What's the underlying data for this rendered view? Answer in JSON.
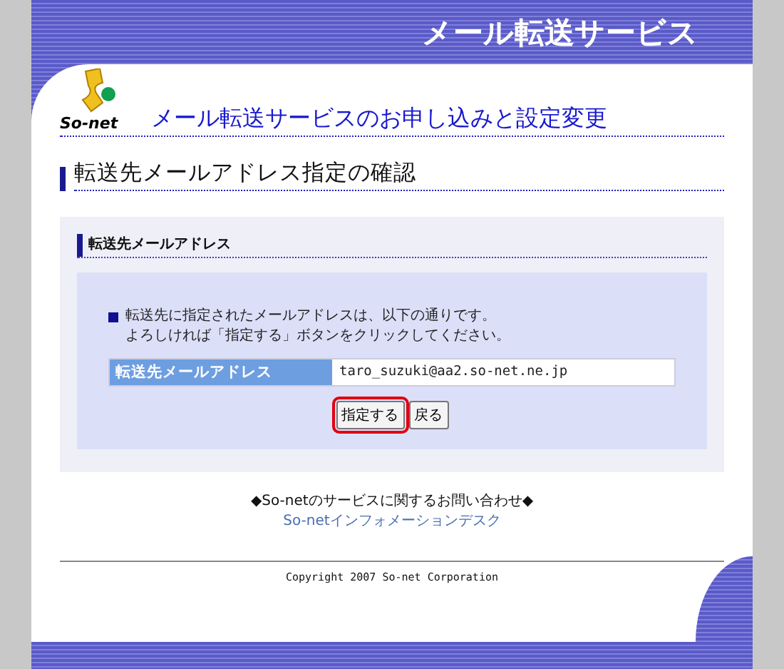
{
  "header": {
    "title": "メール転送サービス"
  },
  "logo": {
    "text": "So-net"
  },
  "page_title": "メール転送サービスのお申し込みと設定変更",
  "heading": "転送先メールアドレス指定の確認",
  "section": {
    "title": "転送先メールアドレス",
    "message": [
      "転送先に指定されたメールアドレスは、以下の通りです。",
      "よろしければ「指定する」ボタンをクリックしてください。"
    ],
    "field": {
      "label": "転送先メールアドレス",
      "value": "taro_suzuki@aa2.so-net.ne.jp"
    },
    "buttons": [
      {
        "label": "指定する",
        "highlighted": true
      },
      {
        "label": "戻る",
        "highlighted": false
      }
    ]
  },
  "footer": {
    "inquiry": "◆So-netのサービスに関するお問い合わせ◆",
    "link": "So-netインフォメーションデスク",
    "copyright": "Copyright 2007 So-net Corporation"
  }
}
